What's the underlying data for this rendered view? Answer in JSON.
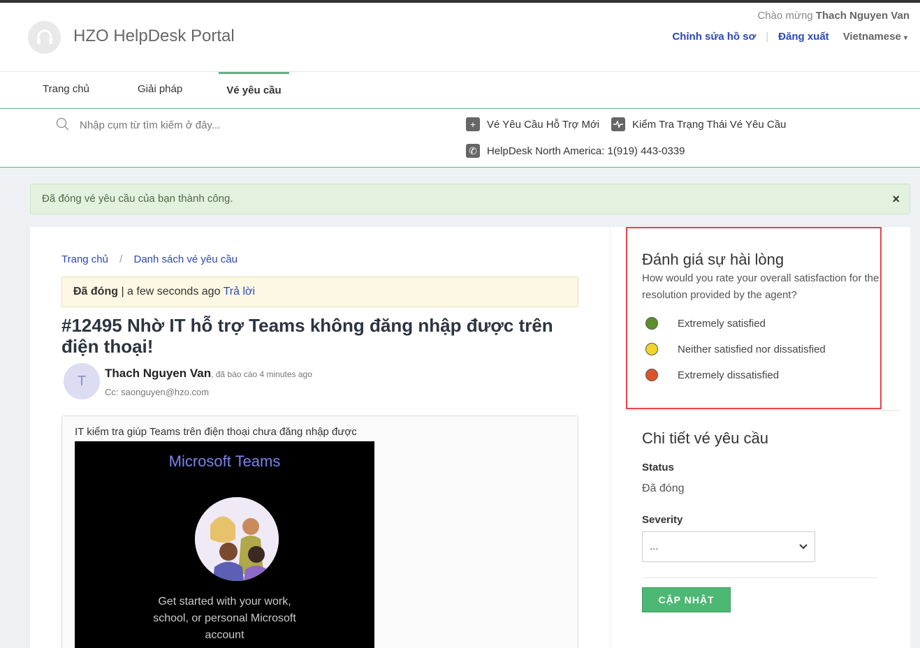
{
  "header": {
    "portal_name": "HZO HelpDesk Portal",
    "welcome_prefix": "Chào mừng",
    "user_name": "Thach Nguyen Van",
    "edit_profile": "Chỉnh sửa hồ sơ",
    "logout": "Đăng xuất",
    "language": "Vietnamese"
  },
  "nav": {
    "tabs": [
      {
        "label": "Trang chủ"
      },
      {
        "label": "Giải pháp"
      },
      {
        "label": "Vé yêu cầu",
        "active": true
      }
    ]
  },
  "search": {
    "placeholder": "Nhập cụm từ tìm kiếm ở đây..."
  },
  "actions": {
    "new_ticket": "Vé Yêu Cầu Hỗ Trợ Mới",
    "check_status": "Kiểm Tra Trạng Thái Vé Yêu Cầu",
    "phone": "HelpDesk North America: 1(919) 443-0339"
  },
  "alert": {
    "message": "Đã đóng vé yêu cầu của bạn thành công.",
    "close": "×"
  },
  "breadcrumb": {
    "home": "Trang chủ",
    "list": "Danh sách vé yêu cầu"
  },
  "ticket": {
    "state": "Đã đóng",
    "time": "a few seconds ago",
    "reply": "Trả lời",
    "title": "#12495 Nhờ IT hỗ trợ Teams không đăng nhập được trên điện thoại!",
    "avatar_letter": "T",
    "reporter": "Thach Nguyen Van",
    "reported_text": ", đã báo cáo 4 minutes ago",
    "cc": "Cc: saonguyen@hzo.com",
    "message": "IT kiểm tra giúp Teams trên điện thoại chưa đăng nhập được",
    "screenshot": {
      "app_title": "Microsoft Teams",
      "caption": "Get started with your work, school, or personal Microsoft account"
    }
  },
  "rating": {
    "title": "Đánh giá sự hài lòng",
    "question": "How would you rate your overall satisfaction for the resolution provided by the agent?",
    "options": [
      {
        "label": "Extremely satisfied",
        "color": "#5a8f2a"
      },
      {
        "label": "Neither satisfied nor dissatisfied",
        "color": "#f2d52b"
      },
      {
        "label": "Extremely dissatisfied",
        "color": "#e0522a"
      }
    ]
  },
  "details": {
    "title": "Chi tiết vé yêu cầu",
    "status_label": "Status",
    "status_value": "Đã đóng",
    "severity_label": "Severity",
    "severity_value": "...",
    "update_button": "CẬP NHẬT"
  }
}
